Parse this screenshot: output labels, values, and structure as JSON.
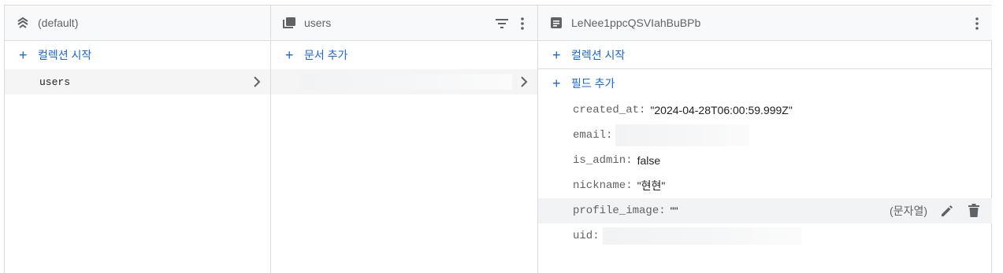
{
  "col1": {
    "title": "(default)",
    "add_label": "컬렉션 시작",
    "items": [
      {
        "label": "users"
      }
    ]
  },
  "col2": {
    "title": "users",
    "add_label": "문서 추가"
  },
  "col3": {
    "title": "LeNee1ppcQSVIahBuBPb",
    "add_collection_label": "컬렉션 시작",
    "add_field_label": "필드 추가",
    "fields": [
      {
        "key": "created_at:",
        "value": "\"2024-04-28T06:00:59.999Z\""
      },
      {
        "key": "email:",
        "value": ""
      },
      {
        "key": "is_admin:",
        "value": "false"
      },
      {
        "key": "nickname:",
        "value": "\"현현\""
      },
      {
        "key": "profile_image:",
        "value": "\"\"",
        "type_label": "(문자열)"
      },
      {
        "key": "uid:",
        "value": ""
      }
    ]
  },
  "icons": [
    "database-stack-icon",
    "collection-icon",
    "document-icon",
    "filter-icon",
    "more-vert-icon",
    "chevron-right-icon",
    "plus-icon",
    "edit-icon",
    "delete-icon"
  ],
  "colors": {
    "accent": "#1967d2",
    "border": "#dadce0",
    "header_bg": "#f8f9fa",
    "selected_bg": "#f5f5f5"
  }
}
